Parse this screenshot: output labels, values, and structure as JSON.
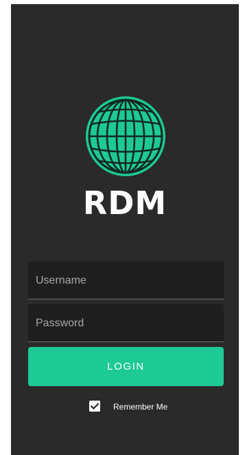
{
  "app": {
    "logo_text": "RDM",
    "logo_icon": "globe-icon",
    "accent_color": "#1dc994"
  },
  "form": {
    "username": {
      "placeholder": "Username",
      "value": ""
    },
    "password": {
      "placeholder": "Password",
      "value": ""
    },
    "login_label": "LOGIN",
    "remember_me": {
      "label": "Remember Me",
      "checked": true
    }
  }
}
